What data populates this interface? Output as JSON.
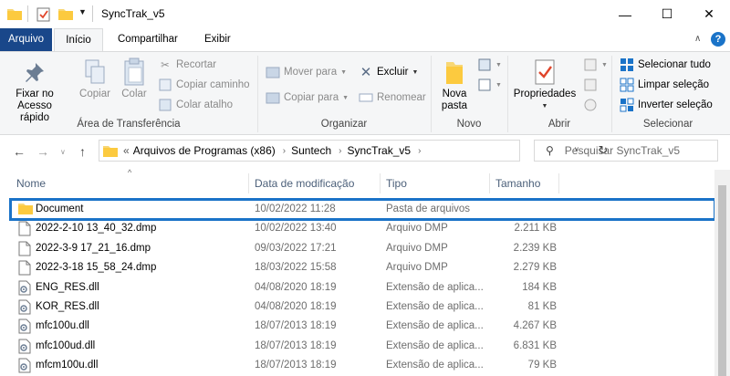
{
  "window": {
    "title": "SyncTrak_v5",
    "minimize": "—",
    "maximize": "☐",
    "close": "✕"
  },
  "ribbon_tabs": [
    "Arquivo",
    "Início",
    "Compartilhar",
    "Exibir"
  ],
  "ribbon": {
    "clipboard": {
      "pin_label_1": "Fixar no",
      "pin_label_2": "Acesso rápido",
      "copy": "Copiar",
      "paste": "Colar",
      "cut": "Recortar",
      "copy_path": "Copiar caminho",
      "paste_shortcut": "Colar atalho",
      "group": "Área de Transferência"
    },
    "organize": {
      "move_to": "Mover para",
      "copy_to": "Copiar para",
      "delete": "Excluir",
      "rename": "Renomear",
      "group": "Organizar"
    },
    "new": {
      "new_folder_1": "Nova",
      "new_folder_2": "pasta",
      "group": "Novo"
    },
    "open": {
      "properties": "Propriedades",
      "group": "Abrir"
    },
    "select": {
      "select_all": "Selecionar tudo",
      "select_none": "Limpar seleção",
      "invert": "Inverter seleção",
      "group": "Selecionar"
    }
  },
  "address": {
    "prefix": "«",
    "crumbs": [
      "Arquivos de Programas (x86)",
      "Suntech",
      "SyncTrak_v5"
    ]
  },
  "search": {
    "placeholder": "Pesquisar SyncTrak_v5"
  },
  "columns": [
    "Nome",
    "Data de modificação",
    "Tipo",
    "Tamanho"
  ],
  "files": [
    {
      "name": "Document",
      "date": "10/02/2022 11:28",
      "type": "Pasta de arquivos",
      "size": "",
      "icon": "folder-icon",
      "selected": true
    },
    {
      "name": "2022-2-10 13_40_32.dmp",
      "date": "10/02/2022 13:40",
      "type": "Arquivo DMP",
      "size": "2.211 KB",
      "icon": "file-icon"
    },
    {
      "name": "2022-3-9 17_21_16.dmp",
      "date": "09/03/2022 17:21",
      "type": "Arquivo DMP",
      "size": "2.239 KB",
      "icon": "file-icon"
    },
    {
      "name": "2022-3-18 15_58_24.dmp",
      "date": "18/03/2022 15:58",
      "type": "Arquivo DMP",
      "size": "2.279 KB",
      "icon": "file-icon"
    },
    {
      "name": "ENG_RES.dll",
      "date": "04/08/2020 18:19",
      "type": "Extensão de aplica...",
      "size": "184 KB",
      "icon": "dll-icon"
    },
    {
      "name": "KOR_RES.dll",
      "date": "04/08/2020 18:19",
      "type": "Extensão de aplica...",
      "size": "81 KB",
      "icon": "dll-icon"
    },
    {
      "name": "mfc100u.dll",
      "date": "18/07/2013 18:19",
      "type": "Extensão de aplica...",
      "size": "4.267 KB",
      "icon": "dll-icon"
    },
    {
      "name": "mfc100ud.dll",
      "date": "18/07/2013 18:19",
      "type": "Extensão de aplica...",
      "size": "6.831 KB",
      "icon": "dll-icon"
    },
    {
      "name": "mfcm100u.dll",
      "date": "18/07/2013 18:19",
      "type": "Extensão de aplica...",
      "size": "79 KB",
      "icon": "dll-icon"
    }
  ]
}
